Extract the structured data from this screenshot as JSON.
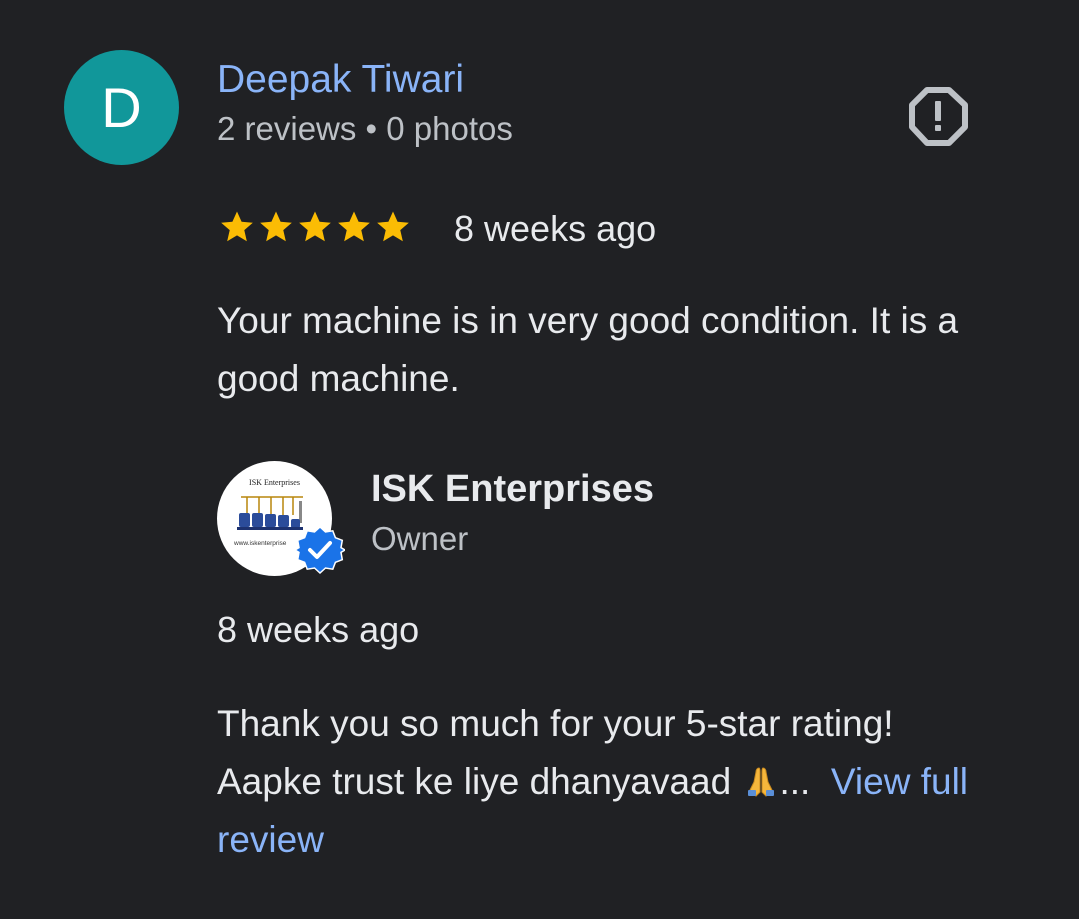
{
  "review": {
    "avatar_letter": "D",
    "avatar_color": "#11979a",
    "reviewer_name": "Deepak Tiwari",
    "reviewer_meta": "2 reviews • 0 photos",
    "report_icon": "report-octagon-icon",
    "rating": 5,
    "rating_max": 5,
    "star_color": "#fbbc04",
    "date": "8 weeks ago",
    "text": "Your machine is in very good condition. It is a good machine."
  },
  "owner_reply": {
    "logo_title": "ISK Enterprises",
    "logo_url": "www.iskenterprise",
    "name": "ISK Enterprises",
    "role": "Owner",
    "verified_icon": "verified-badge-icon",
    "verified_color": "#1a73e8",
    "date": "8 weeks ago",
    "text_line1": "Thank you so much for your 5-star rating!",
    "text_line2": "Aapke trust ke liye dhanyavaad",
    "emoji": "folded-hands-icon",
    "ellipsis": "...",
    "view_full_review": "View full review"
  },
  "link_color": "#8ab4f8"
}
